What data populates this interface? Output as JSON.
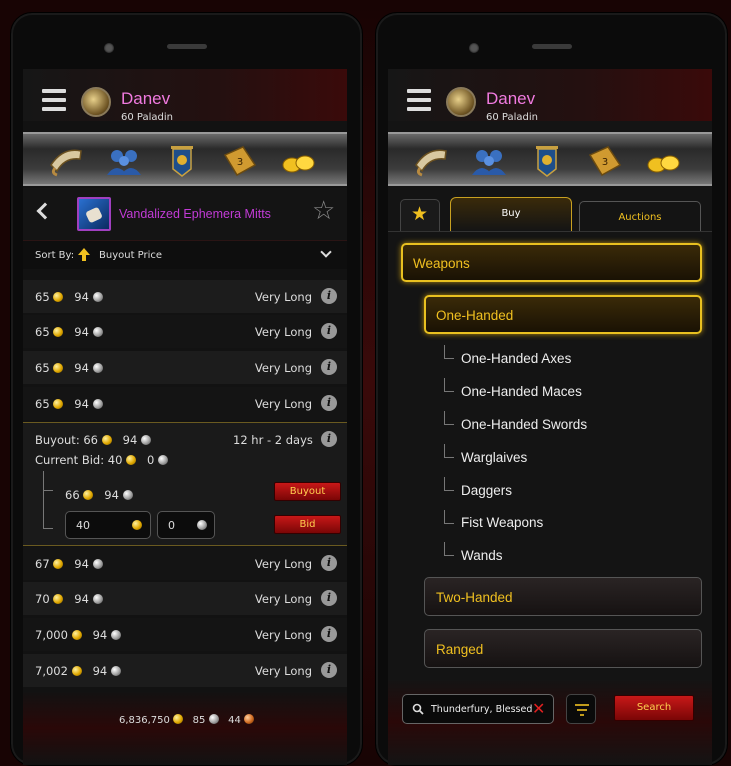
{
  "left": {
    "character": {
      "name": "Danev",
      "level": "60 Paladin"
    },
    "nav_icons": [
      "horn-icon",
      "guild-icon",
      "banner-icon",
      "auction-book-icon",
      "gold-coins-icon"
    ],
    "nav_badge": "3",
    "item": {
      "name": "Vandalized Ephemera Mitts",
      "color": "#c23bd6"
    },
    "sort": {
      "label": "Sort By:",
      "value": "Buyout Price"
    },
    "rows_top": [
      {
        "gold": "65",
        "silver": "94",
        "time": "Very Long"
      },
      {
        "gold": "65",
        "silver": "94",
        "time": "Very Long"
      },
      {
        "gold": "65",
        "silver": "94",
        "time": "Very Long"
      },
      {
        "gold": "65",
        "silver": "94",
        "time": "Very Long"
      }
    ],
    "expanded": {
      "buyout_label": "Buyout:",
      "buyout_gold": "66",
      "buyout_silver": "94",
      "time": "12 hr - 2 days",
      "bid_label": "Current Bid:",
      "bid_gold": "40",
      "bid_silver": "0",
      "pay_gold": "66",
      "pay_silver": "94",
      "buyout_button": "Buyout",
      "bid_gold_input": "40",
      "bid_silver_input": "0",
      "bid_button": "Bid"
    },
    "rows_bottom": [
      {
        "gold": "67",
        "silver": "94",
        "time": "Very Long"
      },
      {
        "gold": "70",
        "silver": "94",
        "time": "Very Long"
      },
      {
        "gold": "7,000",
        "silver": "94",
        "time": "Very Long"
      },
      {
        "gold": "7,002",
        "silver": "94",
        "time": "Very Long"
      }
    ],
    "wallet": {
      "gold": "6,836,750",
      "silver": "85",
      "copper": "44"
    }
  },
  "right": {
    "character": {
      "name": "Danev",
      "level": "60 Paladin"
    },
    "tabs": {
      "buy": "Buy",
      "auctions": "Auctions"
    },
    "categories": {
      "weapons": "Weapons",
      "one_handed": "One-Handed",
      "subcategories": [
        "One-Handed Axes",
        "One-Handed Maces",
        "One-Handed Swords",
        "Warglaives",
        "Daggers",
        "Fist Weapons",
        "Wands"
      ],
      "two_handed": "Two-Handed",
      "ranged": "Ranged"
    },
    "search": {
      "value": "Thunderfury, Blessed",
      "button": "Search"
    }
  },
  "colors": {
    "accent_gold": "#f0c020",
    "name_pink": "#f07adf",
    "button_red": "#b81010"
  }
}
